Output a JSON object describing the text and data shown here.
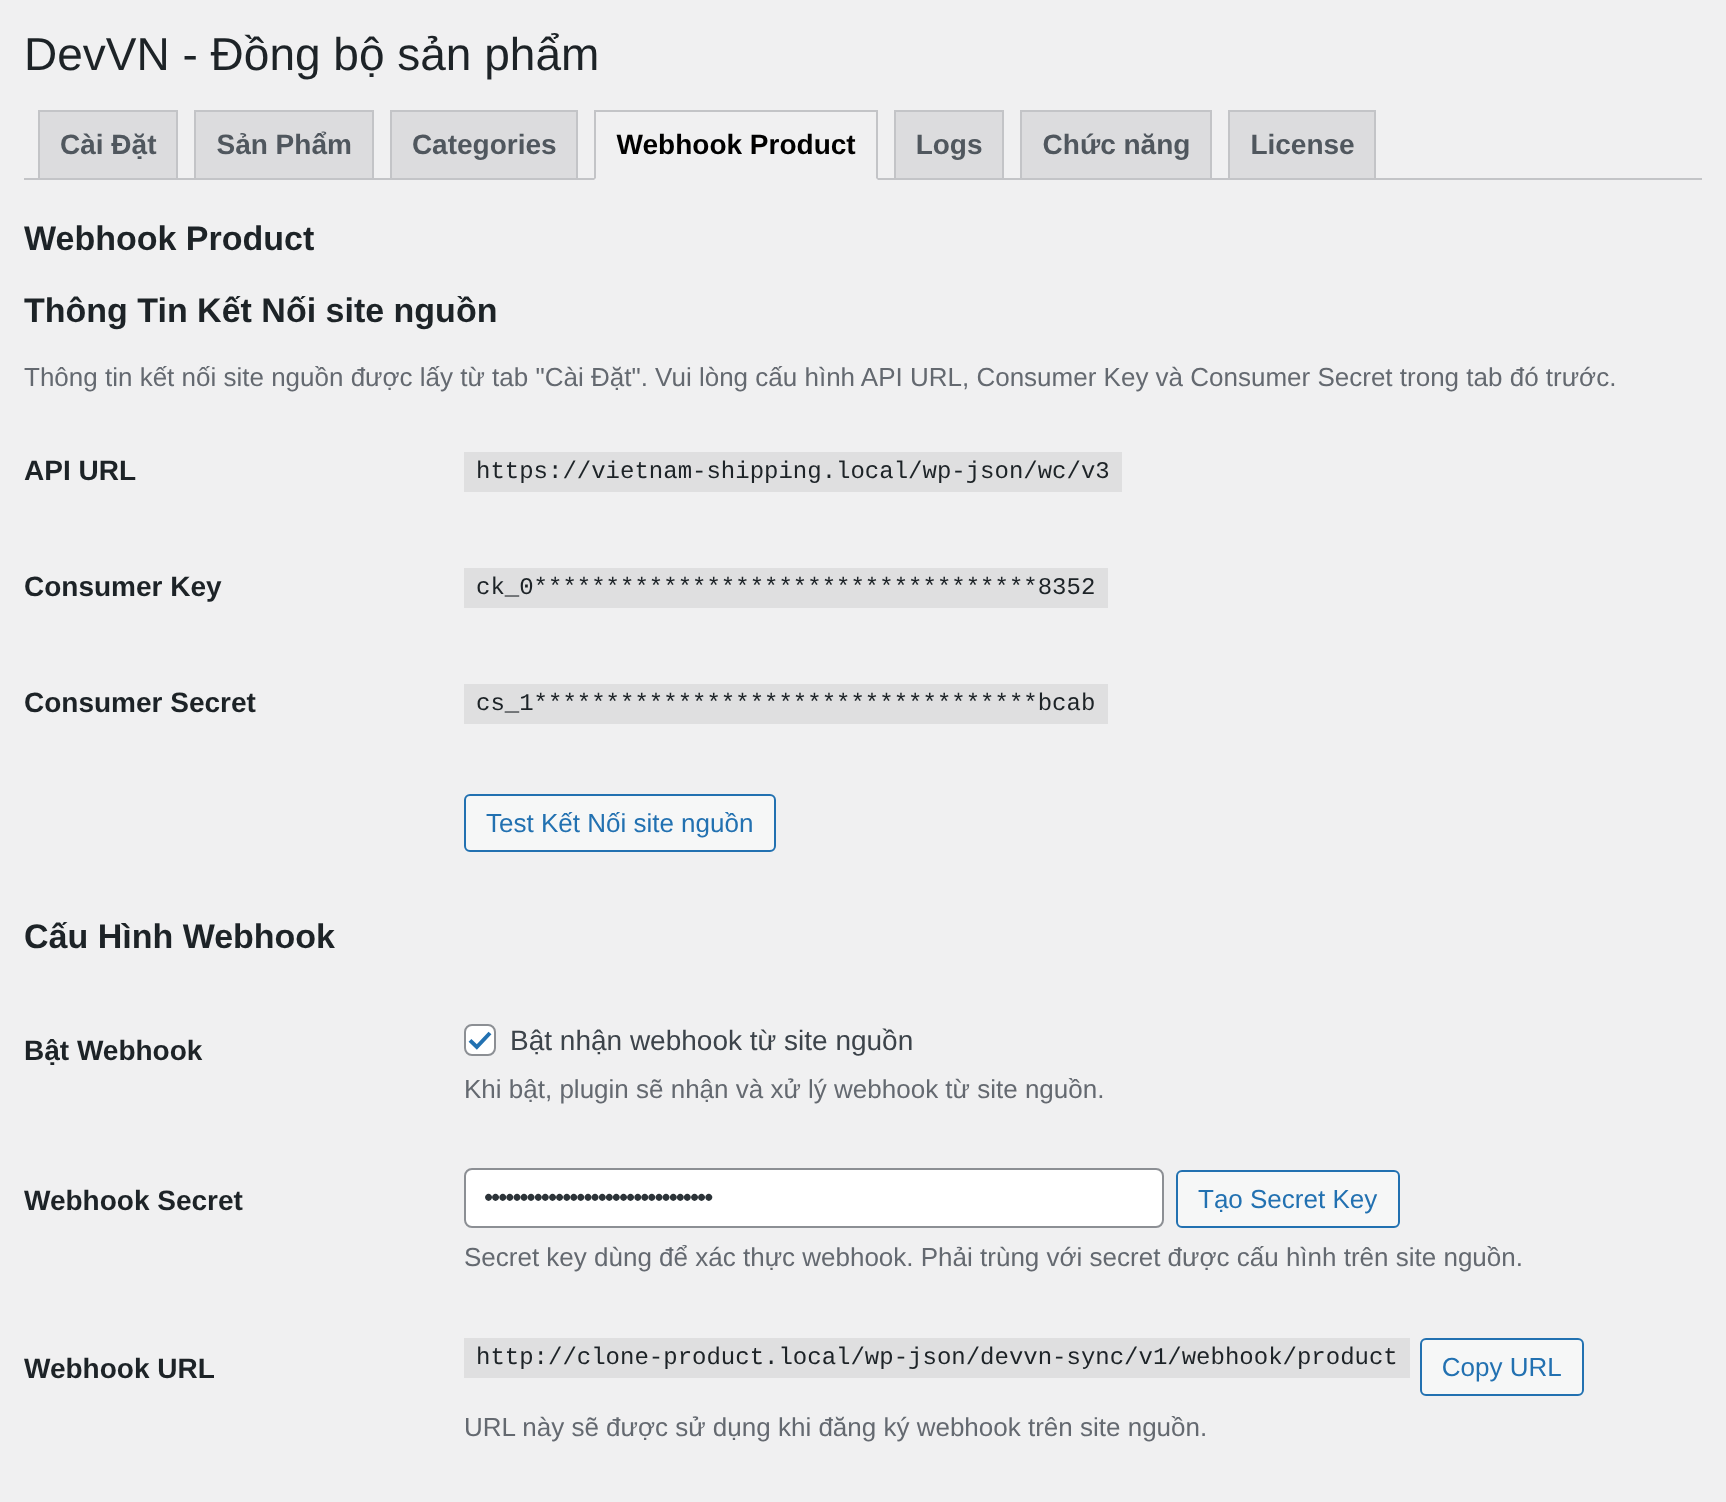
{
  "page_title": "DevVN - Đồng bộ sản phẩm",
  "tabs": [
    {
      "label": "Cài Đặt",
      "selected": false
    },
    {
      "label": "Sản Phẩm",
      "selected": false
    },
    {
      "label": "Categories",
      "selected": false
    },
    {
      "label": "Webhook Product",
      "selected": true
    },
    {
      "label": "Logs",
      "selected": false
    },
    {
      "label": "Chức năng",
      "selected": false
    },
    {
      "label": "License",
      "selected": false
    }
  ],
  "section_title": "Webhook Product",
  "connection": {
    "heading": "Thông Tin Kết Nối site nguồn",
    "description": "Thông tin kết nối site nguồn được lấy từ tab \"Cài Đặt\". Vui lòng cấu hình API URL, Consumer Key và Consumer Secret trong tab đó trước.",
    "fields": [
      {
        "label": "API URL",
        "value": "https://vietnam-shipping.local/wp-json/wc/v3"
      },
      {
        "label": "Consumer Key",
        "value": "ck_0***********************************8352"
      },
      {
        "label": "Consumer Secret",
        "value": "cs_1***********************************bcab"
      }
    ],
    "test_button": "Test Kết Nối site nguồn"
  },
  "webhook_config": {
    "heading": "Cấu Hình Webhook",
    "rows": [
      {
        "kind": "checkbox",
        "label": "Bật Webhook",
        "checkbox_label": "Bật nhận webhook từ site nguồn",
        "checked": true,
        "description": "Khi bật, plugin sẽ nhận và xử lý webhook từ site nguồn."
      },
      {
        "kind": "password",
        "label": "Webhook Secret",
        "value": "••••••••••••••••••••••••••••••••",
        "button": "Tạo Secret Key",
        "description": "Secret key dùng để xác thực webhook. Phải trùng với secret được cấu hình trên site nguồn."
      },
      {
        "kind": "code",
        "label": "Webhook URL",
        "value": "http://clone-product.local/wp-json/devvn-sync/v1/webhook/product",
        "button": "Copy URL",
        "description": "URL này sẽ được sử dụng khi đăng ký webhook trên site nguồn."
      }
    ]
  }
}
